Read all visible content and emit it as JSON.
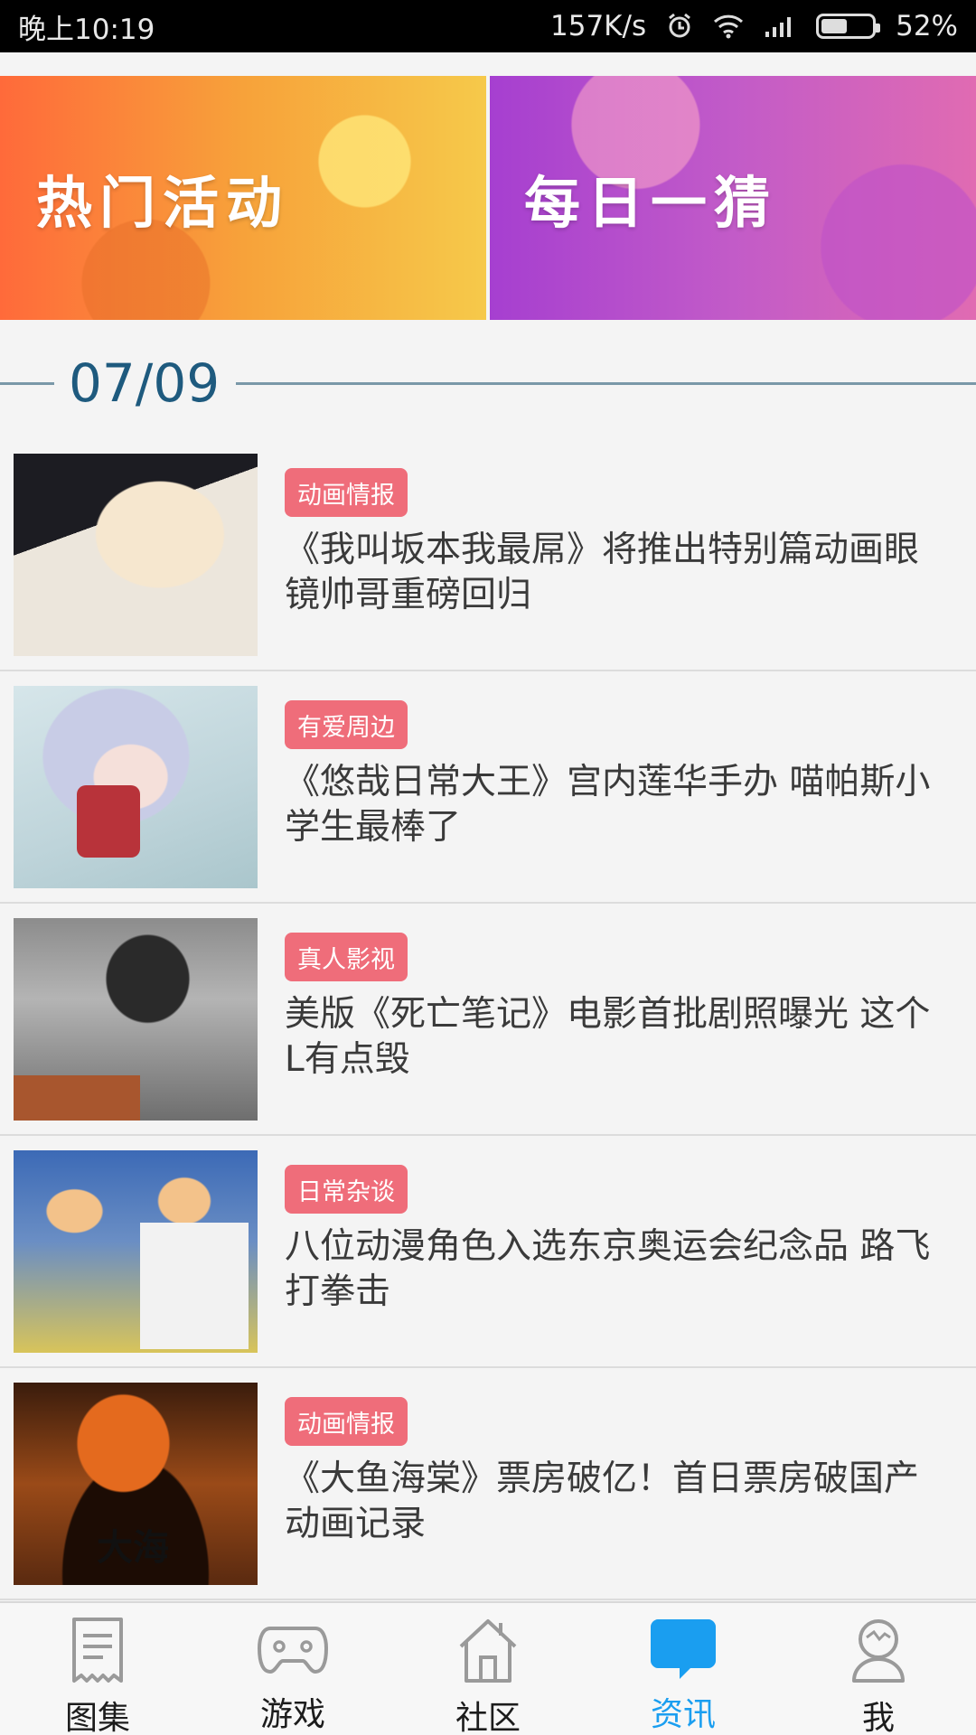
{
  "status_bar": {
    "time": "晚上10:19",
    "net_speed": "157K/s",
    "battery": "52%",
    "battery_level": 0.52
  },
  "banners": [
    {
      "title": "热门活动"
    },
    {
      "title": "每日一猜"
    }
  ],
  "date_divider": "07/09",
  "news": [
    {
      "tag": "动画情报",
      "title": "《我叫坂本我最屌》将推出特别篇动画眼镜帅哥重磅回归"
    },
    {
      "tag": "有爱周边",
      "title": "《悠哉日常大王》宫内莲华手办 喵帕斯小学生最棒了"
    },
    {
      "tag": "真人影视",
      "title": "美版《死亡笔记》电影首批剧照曝光 这个L有点毁"
    },
    {
      "tag": "日常杂谈",
      "title": "八位动漫角色入选东京奥运会纪念品 路飞打拳击"
    },
    {
      "tag": "动画情报",
      "title": "《大鱼海棠》票房破亿！首日票房破国产动画记录",
      "thumb_text": "大海"
    }
  ],
  "bottom_nav": [
    {
      "label": "图集",
      "icon": "album-icon"
    },
    {
      "label": "游戏",
      "icon": "gamepad-icon"
    },
    {
      "label": "社区",
      "icon": "home-icon"
    },
    {
      "label": "资讯",
      "icon": "chat-bubble-icon",
      "active": true
    },
    {
      "label": "我",
      "icon": "profile-icon"
    }
  ],
  "colors": {
    "accent": "#1a9ef0",
    "tag_bg": "#ef6d7a",
    "date_text": "#1e5a7e"
  }
}
